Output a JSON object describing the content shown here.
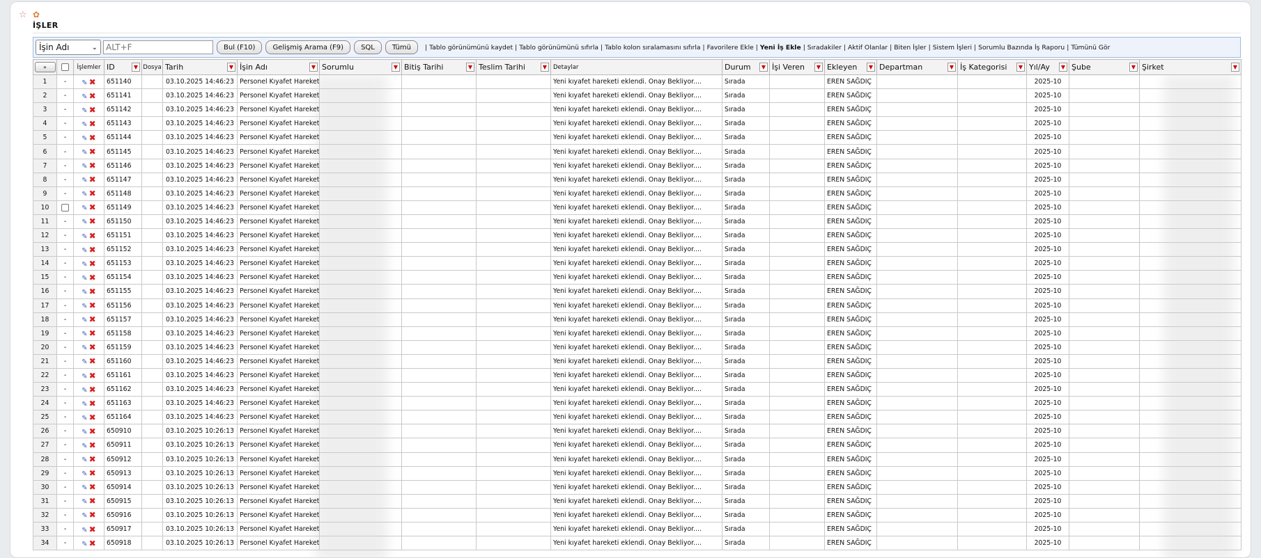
{
  "page": {
    "title": "İŞLER"
  },
  "toolbar": {
    "search_field_select": "İşin Adı",
    "search_placeholder": "ALT+F",
    "buttons": {
      "find": "Bul (F10)",
      "advanced": "Gelişmiş Arama (F9)",
      "sql": "SQL",
      "all": "Tümü"
    },
    "links": [
      "Tablo görünümünü kaydet",
      "Tablo görünümünü sıfırla",
      "Tablo kolon sıralamasını sıfırla",
      "Favorilere Ekle",
      "Yeni İş Ekle",
      "Sıradakiler",
      "Aktif Olanlar",
      "Biten İşler",
      "Sistem İşleri",
      "Sorumlu Bazında İş Raporu",
      "Tümünü Gör"
    ]
  },
  "table": {
    "expand_label": "»",
    "headers": {
      "islemler": "İşlemler",
      "id": "ID",
      "dosya": "Dosya",
      "tarih": "Tarih",
      "isin_adi": "İşin Adı",
      "sorumlu": "Sorumlu",
      "bitis": "Bitiş Tarihi",
      "teslim": "Teslim Tarihi",
      "detaylar": "Detaylar",
      "durum": "Durum",
      "isi_veren": "İşi Veren",
      "ekleyen": "Ekleyen",
      "departman": "Departman",
      "kategori": "İş Kategorisi",
      "yil_ay": "Yıl/Ay",
      "sube": "Şube",
      "sirket": "Şirket"
    },
    "rows": [
      {
        "no": "1",
        "dash": "-",
        "id": "651140",
        "tarih": "03.10.2025 14:46:23",
        "isin_adi": "Personel Kıyafet Hareketi",
        "detay": "Yeni kıyafet hareketi eklendi. Onay Bekliyor....",
        "durum": "Sırada",
        "ekleyen": "EREN SAĞDIÇ",
        "yil_ay": "2025-10"
      },
      {
        "no": "2",
        "dash": "-",
        "id": "651141",
        "tarih": "03.10.2025 14:46:23",
        "isin_adi": "Personel Kıyafet Hareketi",
        "detay": "Yeni kıyafet hareketi eklendi. Onay Bekliyor....",
        "durum": "Sırada",
        "ekleyen": "EREN SAĞDIÇ",
        "yil_ay": "2025-10"
      },
      {
        "no": "3",
        "dash": "-",
        "id": "651142",
        "tarih": "03.10.2025 14:46:23",
        "isin_adi": "Personel Kıyafet Hareketi",
        "detay": "Yeni kıyafet hareketi eklendi. Onay Bekliyor....",
        "durum": "Sırada",
        "ekleyen": "EREN SAĞDIÇ",
        "yil_ay": "2025-10"
      },
      {
        "no": "4",
        "dash": "-",
        "id": "651143",
        "tarih": "03.10.2025 14:46:23",
        "isin_adi": "Personel Kıyafet Hareketi",
        "detay": "Yeni kıyafet hareketi eklendi. Onay Bekliyor....",
        "durum": "Sırada",
        "ekleyen": "EREN SAĞDIÇ",
        "yil_ay": "2025-10"
      },
      {
        "no": "5",
        "dash": "-",
        "id": "651144",
        "tarih": "03.10.2025 14:46:23",
        "isin_adi": "Personel Kıyafet Hareketi",
        "detay": "Yeni kıyafet hareketi eklendi. Onay Bekliyor....",
        "durum": "Sırada",
        "ekleyen": "EREN SAĞDIÇ",
        "yil_ay": "2025-10"
      },
      {
        "no": "6",
        "dash": "-",
        "id": "651145",
        "tarih": "03.10.2025 14:46:23",
        "isin_adi": "Personel Kıyafet Hareketi",
        "detay": "Yeni kıyafet hareketi eklendi. Onay Bekliyor....",
        "durum": "Sırada",
        "ekleyen": "EREN SAĞDIÇ",
        "yil_ay": "2025-10"
      },
      {
        "no": "7",
        "dash": "-",
        "id": "651146",
        "tarih": "03.10.2025 14:46:23",
        "isin_adi": "Personel Kıyafet Hareketi",
        "detay": "Yeni kıyafet hareketi eklendi. Onay Bekliyor....",
        "durum": "Sırada",
        "ekleyen": "EREN SAĞDIÇ",
        "yil_ay": "2025-10"
      },
      {
        "no": "8",
        "dash": "-",
        "id": "651147",
        "tarih": "03.10.2025 14:46:23",
        "isin_adi": "Personel Kıyafet Hareketi",
        "detay": "Yeni kıyafet hareketi eklendi. Onay Bekliyor....",
        "durum": "Sırada",
        "ekleyen": "EREN SAĞDIÇ",
        "yil_ay": "2025-10"
      },
      {
        "no": "9",
        "dash": "-",
        "id": "651148",
        "tarih": "03.10.2025 14:46:23",
        "isin_adi": "Personel Kıyafet Hareketi",
        "detay": "Yeni kıyafet hareketi eklendi. Onay Bekliyor....",
        "durum": "Sırada",
        "ekleyen": "EREN SAĞDIÇ",
        "yil_ay": "2025-10"
      },
      {
        "no": "10",
        "dash": "",
        "checkbox": true,
        "id": "651149",
        "tarih": "03.10.2025 14:46:23",
        "isin_adi": "Personel Kıyafet Hareketi",
        "detay": "Yeni kıyafet hareketi eklendi. Onay Bekliyor....",
        "durum": "Sırada",
        "ekleyen": "EREN SAĞDIÇ",
        "yil_ay": "2025-10"
      },
      {
        "no": "11",
        "dash": "-",
        "id": "651150",
        "tarih": "03.10.2025 14:46:23",
        "isin_adi": "Personel Kıyafet Hareketi",
        "detay": "Yeni kıyafet hareketi eklendi. Onay Bekliyor....",
        "durum": "Sırada",
        "ekleyen": "EREN SAĞDIÇ",
        "yil_ay": "2025-10"
      },
      {
        "no": "12",
        "dash": "-",
        "id": "651151",
        "tarih": "03.10.2025 14:46:23",
        "isin_adi": "Personel Kıyafet Hareketi",
        "detay": "Yeni kıyafet hareketi eklendi. Onay Bekliyor....",
        "durum": "Sırada",
        "ekleyen": "EREN SAĞDIÇ",
        "yil_ay": "2025-10"
      },
      {
        "no": "13",
        "dash": "-",
        "id": "651152",
        "tarih": "03.10.2025 14:46:23",
        "isin_adi": "Personel Kıyafet Hareketi",
        "detay": "Yeni kıyafet hareketi eklendi. Onay Bekliyor....",
        "durum": "Sırada",
        "ekleyen": "EREN SAĞDIÇ",
        "yil_ay": "2025-10"
      },
      {
        "no": "14",
        "dash": "-",
        "id": "651153",
        "tarih": "03.10.2025 14:46:23",
        "isin_adi": "Personel Kıyafet Hareketi",
        "detay": "Yeni kıyafet hareketi eklendi. Onay Bekliyor....",
        "durum": "Sırada",
        "ekleyen": "EREN SAĞDIÇ",
        "yil_ay": "2025-10"
      },
      {
        "no": "15",
        "dash": "-",
        "id": "651154",
        "tarih": "03.10.2025 14:46:23",
        "isin_adi": "Personel Kıyafet Hareketi",
        "detay": "Yeni kıyafet hareketi eklendi. Onay Bekliyor....",
        "durum": "Sırada",
        "ekleyen": "EREN SAĞDIÇ",
        "yil_ay": "2025-10"
      },
      {
        "no": "16",
        "dash": "-",
        "id": "651155",
        "tarih": "03.10.2025 14:46:23",
        "isin_adi": "Personel Kıyafet Hareketi",
        "detay": "Yeni kıyafet hareketi eklendi. Onay Bekliyor....",
        "durum": "Sırada",
        "ekleyen": "EREN SAĞDIÇ",
        "yil_ay": "2025-10"
      },
      {
        "no": "17",
        "dash": "-",
        "id": "651156",
        "tarih": "03.10.2025 14:46:23",
        "isin_adi": "Personel Kıyafet Hareketi",
        "detay": "Yeni kıyafet hareketi eklendi. Onay Bekliyor....",
        "durum": "Sırada",
        "ekleyen": "EREN SAĞDIÇ",
        "yil_ay": "2025-10"
      },
      {
        "no": "18",
        "dash": "-",
        "id": "651157",
        "tarih": "03.10.2025 14:46:23",
        "isin_adi": "Personel Kıyafet Hareketi",
        "detay": "Yeni kıyafet hareketi eklendi. Onay Bekliyor....",
        "durum": "Sırada",
        "ekleyen": "EREN SAĞDIÇ",
        "yil_ay": "2025-10"
      },
      {
        "no": "19",
        "dash": "-",
        "id": "651158",
        "tarih": "03.10.2025 14:46:23",
        "isin_adi": "Personel Kıyafet Hareketi",
        "detay": "Yeni kıyafet hareketi eklendi. Onay Bekliyor....",
        "durum": "Sırada",
        "ekleyen": "EREN SAĞDIÇ",
        "yil_ay": "2025-10"
      },
      {
        "no": "20",
        "dash": "-",
        "id": "651159",
        "tarih": "03.10.2025 14:46:23",
        "isin_adi": "Personel Kıyafet Hareketi",
        "detay": "Yeni kıyafet hareketi eklendi. Onay Bekliyor....",
        "durum": "Sırada",
        "ekleyen": "EREN SAĞDIÇ",
        "yil_ay": "2025-10"
      },
      {
        "no": "21",
        "dash": "-",
        "id": "651160",
        "tarih": "03.10.2025 14:46:23",
        "isin_adi": "Personel Kıyafet Hareketi",
        "detay": "Yeni kıyafet hareketi eklendi. Onay Bekliyor....",
        "durum": "Sırada",
        "ekleyen": "EREN SAĞDIÇ",
        "yil_ay": "2025-10"
      },
      {
        "no": "22",
        "dash": "-",
        "id": "651161",
        "tarih": "03.10.2025 14:46:23",
        "isin_adi": "Personel Kıyafet Hareketi",
        "detay": "Yeni kıyafet hareketi eklendi. Onay Bekliyor....",
        "durum": "Sırada",
        "ekleyen": "EREN SAĞDIÇ",
        "yil_ay": "2025-10"
      },
      {
        "no": "23",
        "dash": "-",
        "id": "651162",
        "tarih": "03.10.2025 14:46:23",
        "isin_adi": "Personel Kıyafet Hareketi",
        "detay": "Yeni kıyafet hareketi eklendi. Onay Bekliyor....",
        "durum": "Sırada",
        "ekleyen": "EREN SAĞDIÇ",
        "yil_ay": "2025-10"
      },
      {
        "no": "24",
        "dash": "-",
        "id": "651163",
        "tarih": "03.10.2025 14:46:23",
        "isin_adi": "Personel Kıyafet Hareketi",
        "detay": "Yeni kıyafet hareketi eklendi. Onay Bekliyor....",
        "durum": "Sırada",
        "ekleyen": "EREN SAĞDIÇ",
        "yil_ay": "2025-10"
      },
      {
        "no": "25",
        "dash": "-",
        "id": "651164",
        "tarih": "03.10.2025 14:46:23",
        "isin_adi": "Personel Kıyafet Hareketi",
        "detay": "Yeni kıyafet hareketi eklendi. Onay Bekliyor....",
        "durum": "Sırada",
        "ekleyen": "EREN SAĞDIÇ",
        "yil_ay": "2025-10"
      },
      {
        "no": "26",
        "dash": "-",
        "id": "650910",
        "tarih": "03.10.2025 10:26:13",
        "isin_adi": "Personel Kıyafet Hareketi",
        "detay": "Yeni kıyafet hareketi eklendi. Onay Bekliyor....",
        "durum": "Sırada",
        "ekleyen": "EREN SAĞDIÇ",
        "yil_ay": "2025-10"
      },
      {
        "no": "27",
        "dash": "-",
        "id": "650911",
        "tarih": "03.10.2025 10:26:13",
        "isin_adi": "Personel Kıyafet Hareketi",
        "detay": "Yeni kıyafet hareketi eklendi. Onay Bekliyor....",
        "durum": "Sırada",
        "ekleyen": "EREN SAĞDIÇ",
        "yil_ay": "2025-10"
      },
      {
        "no": "28",
        "dash": "-",
        "id": "650912",
        "tarih": "03.10.2025 10:26:13",
        "isin_adi": "Personel Kıyafet Hareketi",
        "detay": "Yeni kıyafet hareketi eklendi. Onay Bekliyor....",
        "durum": "Sırada",
        "ekleyen": "EREN SAĞDIÇ",
        "yil_ay": "2025-10"
      },
      {
        "no": "29",
        "dash": "-",
        "id": "650913",
        "tarih": "03.10.2025 10:26:13",
        "isin_adi": "Personel Kıyafet Hareketi",
        "detay": "Yeni kıyafet hareketi eklendi. Onay Bekliyor....",
        "durum": "Sırada",
        "ekleyen": "EREN SAĞDIÇ",
        "yil_ay": "2025-10"
      },
      {
        "no": "30",
        "dash": "-",
        "id": "650914",
        "tarih": "03.10.2025 10:26:13",
        "isin_adi": "Personel Kıyafet Hareketi",
        "detay": "Yeni kıyafet hareketi eklendi. Onay Bekliyor....",
        "durum": "Sırada",
        "ekleyen": "EREN SAĞDIÇ",
        "yil_ay": "2025-10"
      },
      {
        "no": "31",
        "dash": "-",
        "id": "650915",
        "tarih": "03.10.2025 10:26:13",
        "isin_adi": "Personel Kıyafet Hareketi",
        "detay": "Yeni kıyafet hareketi eklendi. Onay Bekliyor....",
        "durum": "Sırada",
        "ekleyen": "EREN SAĞDIÇ",
        "yil_ay": "2025-10"
      },
      {
        "no": "32",
        "dash": "-",
        "id": "650916",
        "tarih": "03.10.2025 10:26:13",
        "isin_adi": "Personel Kıyafet Hareketi",
        "detay": "Yeni kıyafet hareketi eklendi. Onay Bekliyor....",
        "durum": "Sırada",
        "ekleyen": "EREN SAĞDIÇ",
        "yil_ay": "2025-10"
      },
      {
        "no": "33",
        "dash": "-",
        "id": "650917",
        "tarih": "03.10.2025 10:26:13",
        "isin_adi": "Personel Kıyafet Hareketi",
        "detay": "Yeni kıyafet hareketi eklendi. Onay Bekliyor....",
        "durum": "Sırada",
        "ekleyen": "EREN SAĞDIÇ",
        "yil_ay": "2025-10"
      },
      {
        "no": "34",
        "dash": "-",
        "id": "650918",
        "tarih": "03.10.2025 10:26:13",
        "isin_adi": "Personel Kıyafet Hareketi",
        "detay": "Yeni kıyafet hareketi eklendi. Onay Bekliyor....",
        "durum": "Sırada",
        "ekleyen": "EREN SAĞDIÇ",
        "yil_ay": "2025-10"
      }
    ]
  }
}
